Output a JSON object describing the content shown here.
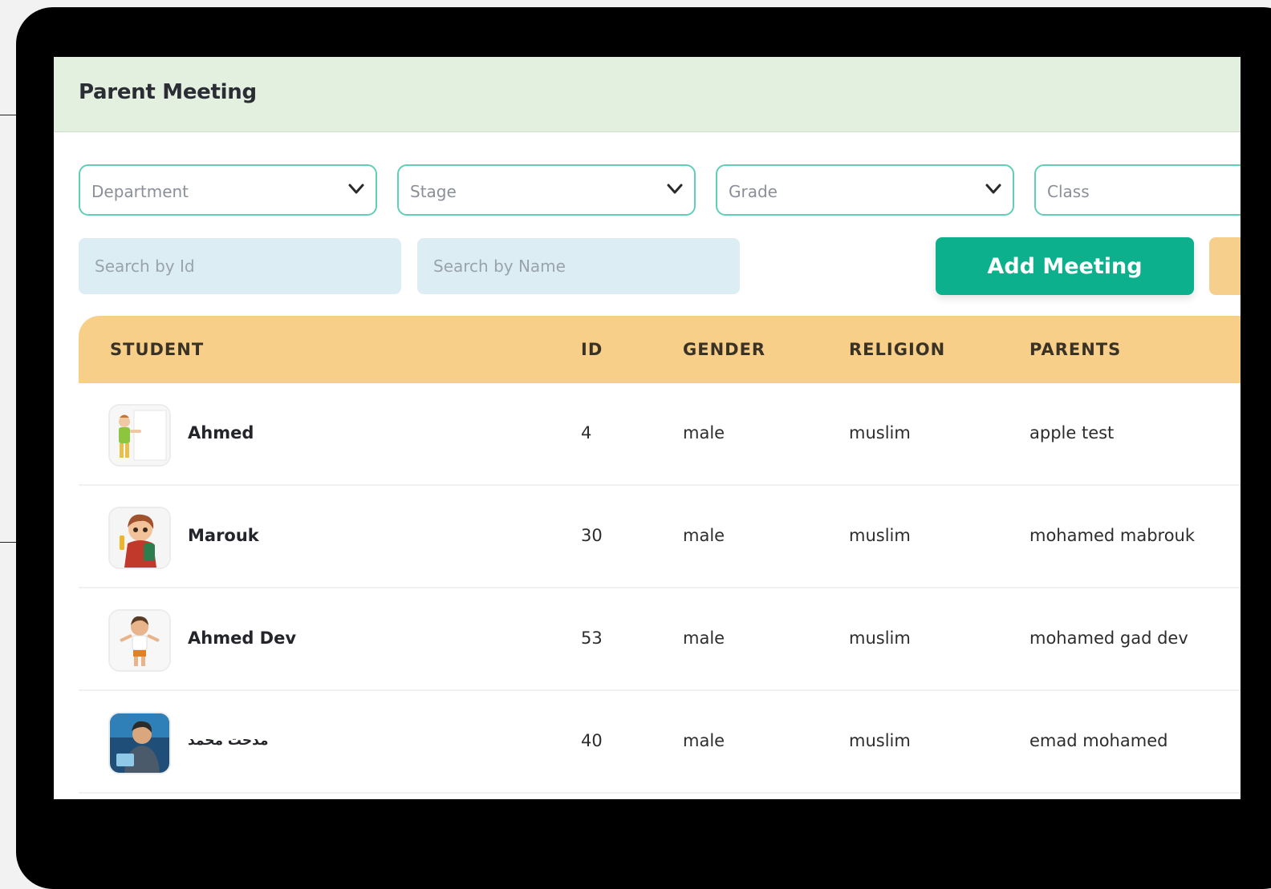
{
  "page": {
    "title": "Parent Meeting"
  },
  "filters": {
    "department": {
      "placeholder": "Department"
    },
    "stage": {
      "placeholder": "Stage"
    },
    "grade": {
      "placeholder": "Grade"
    },
    "class": {
      "placeholder": "Class"
    }
  },
  "search": {
    "by_id_placeholder": "Search by Id",
    "by_name_placeholder": "Search by Name"
  },
  "actions": {
    "add_meeting_label": "Add Meeting"
  },
  "table": {
    "columns": [
      "STUDENT",
      "ID",
      "GENDER",
      "RELIGION",
      "PARENTS"
    ],
    "rows": [
      {
        "student": "Ahmed",
        "id": "4",
        "gender": "male",
        "religion": "muslim",
        "parents": "apple test"
      },
      {
        "student": "Marouk",
        "id": "30",
        "gender": "male",
        "religion": "muslim",
        "parents": "mohamed mabrouk"
      },
      {
        "student": "Ahmed Dev",
        "id": "53",
        "gender": "male",
        "religion": "muslim",
        "parents": "mohamed gad dev"
      },
      {
        "student": "مدحت محمد",
        "id": "40",
        "gender": "male",
        "religion": "muslim",
        "parents": "emad mohamed"
      }
    ]
  },
  "icons": {
    "dropdown": "chevron-down-icon",
    "avatars": [
      "student-avatar-image",
      "student-avatar-image",
      "student-avatar-image",
      "student-avatar-image"
    ]
  },
  "colors": {
    "header_bg": "#e3efdf",
    "select_border": "#5fcfb8",
    "search_bg": "#dcedf4",
    "primary_button": "#0db08c",
    "secondary_button": "#f6cf8d",
    "table_header_bg": "#f7cf88"
  }
}
